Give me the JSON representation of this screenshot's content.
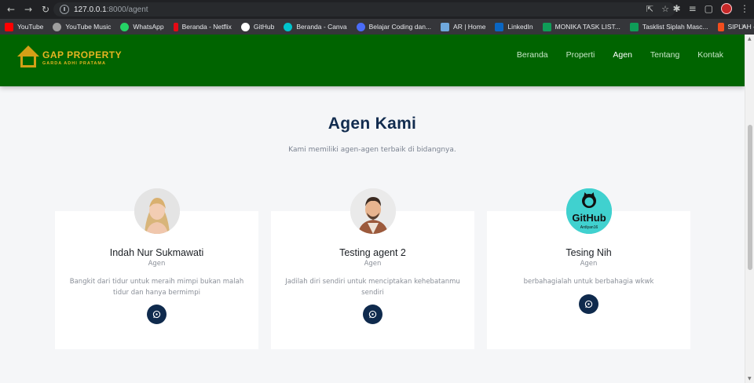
{
  "browser": {
    "url_host": "127.0.0.1",
    "url_path": ":8000/agent",
    "bookmarks": [
      {
        "label": "YouTube",
        "color": "#ff0000"
      },
      {
        "label": "YouTube Music",
        "color": "#9e9e9e"
      },
      {
        "label": "WhatsApp",
        "color": "#25d366"
      },
      {
        "label": "Beranda - Netflix",
        "color": "#e50914"
      },
      {
        "label": "GitHub",
        "color": "#ffffff"
      },
      {
        "label": "Beranda - Canva",
        "color": "#00c4cc"
      },
      {
        "label": "Belajar Coding dan...",
        "color": "#4a6cf7"
      },
      {
        "label": "AR | Home",
        "color": "#6fa8dc"
      },
      {
        "label": "LinkedIn",
        "color": "#0a66c2"
      },
      {
        "label": "MONIKA TASK LIST...",
        "color": "#0f9d58"
      },
      {
        "label": "Tasklist Siplah Masc...",
        "color": "#0f9d58"
      },
      {
        "label": "SIPLAH – Figma",
        "color": "#f24e1e"
      }
    ]
  },
  "site": {
    "logo_title": "GAP PROPERTY",
    "logo_subtitle": "GARDA ADHI PRATAMA",
    "brand_color": "#006400",
    "nav": [
      {
        "label": "Beranda",
        "active": false
      },
      {
        "label": "Properti",
        "active": false
      },
      {
        "label": "Agen",
        "active": true
      },
      {
        "label": "Tentang",
        "active": false
      },
      {
        "label": "Kontak",
        "active": false
      }
    ]
  },
  "section": {
    "title": "Agen Kami",
    "subtitle": "Kami memiliki agen-agen terbaik di bidangnya."
  },
  "agents": [
    {
      "name": "Indah Nur Sukmawati",
      "role": "Agen",
      "bio": "Bangkit dari tidur untuk meraih mimpi bukan malah tidur dan hanya bermimpi",
      "photo_icon": "woman-photo"
    },
    {
      "name": "Testing agent 2",
      "role": "Agen",
      "bio": "Jadilah diri sendiri untuk menciptakan kehebatanmu sendiri",
      "photo_icon": "man-photo"
    },
    {
      "name": "Tesing Nih",
      "role": "Agen",
      "bio": "berbahagialah untuk berbahagia wkwk",
      "photo_icon": "github-logo",
      "photo_text": "GitHub",
      "photo_caption": "Ardiyan16"
    }
  ]
}
